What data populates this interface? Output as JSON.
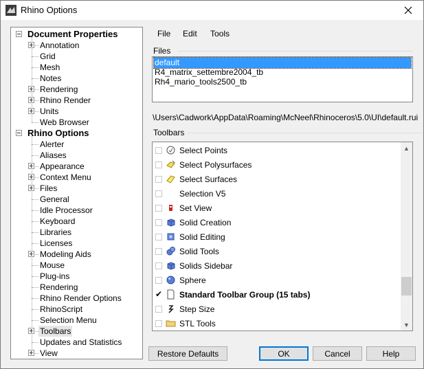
{
  "window": {
    "title": "Rhino Options"
  },
  "tree": {
    "items": [
      {
        "label": "Document Properties",
        "level": 0,
        "bold": true,
        "expander": "minus"
      },
      {
        "label": "Annotation",
        "level": 1,
        "expander": "plus"
      },
      {
        "label": "Grid",
        "level": 1
      },
      {
        "label": "Mesh",
        "level": 1
      },
      {
        "label": "Notes",
        "level": 1
      },
      {
        "label": "Rendering",
        "level": 1,
        "expander": "plus"
      },
      {
        "label": "Rhino Render",
        "level": 1,
        "expander": "plus"
      },
      {
        "label": "Units",
        "level": 1,
        "expander": "plus"
      },
      {
        "label": "Web Browser",
        "level": 1
      },
      {
        "label": "Rhino Options",
        "level": 0,
        "bold": true,
        "expander": "minus"
      },
      {
        "label": "Alerter",
        "level": 1
      },
      {
        "label": "Aliases",
        "level": 1
      },
      {
        "label": "Appearance",
        "level": 1,
        "expander": "plus"
      },
      {
        "label": "Context Menu",
        "level": 1,
        "expander": "plus"
      },
      {
        "label": "Files",
        "level": 1,
        "expander": "plus"
      },
      {
        "label": "General",
        "level": 1
      },
      {
        "label": "Idle Processor",
        "level": 1
      },
      {
        "label": "Keyboard",
        "level": 1
      },
      {
        "label": "Libraries",
        "level": 1
      },
      {
        "label": "Licenses",
        "level": 1
      },
      {
        "label": "Modeling Aids",
        "level": 1,
        "expander": "plus"
      },
      {
        "label": "Mouse",
        "level": 1
      },
      {
        "label": "Plug-ins",
        "level": 1
      },
      {
        "label": "Rendering",
        "level": 1
      },
      {
        "label": "Rhino Render Options",
        "level": 1
      },
      {
        "label": "RhinoScript",
        "level": 1
      },
      {
        "label": "Selection Menu",
        "level": 1
      },
      {
        "label": "Toolbars",
        "level": 1,
        "expander": "plus",
        "selected": true
      },
      {
        "label": "Updates and Statistics",
        "level": 1
      },
      {
        "label": "View",
        "level": 1,
        "expander": "plus"
      }
    ]
  },
  "menu": {
    "items": [
      "File",
      "Edit",
      "Tools"
    ]
  },
  "files": {
    "label": "Files",
    "items": [
      {
        "name": "default",
        "selected": true
      },
      {
        "name": "R4_matrix_settembre2004_tb"
      },
      {
        "name": "Rh4_mario_tools2500_tb"
      }
    ],
    "path": "\\Users\\Cadwork\\AppData\\Roaming\\McNeel\\Rhinoceros\\5.0\\UI\\default.rui"
  },
  "toolbars": {
    "label": "Toolbars",
    "items": [
      {
        "label": "Select Points",
        "icon": "select-points-icon",
        "checked": false
      },
      {
        "label": "Select Polysurfaces",
        "icon": "select-polysurfaces-icon",
        "checked": false
      },
      {
        "label": "Select Surfaces",
        "icon": "select-surfaces-icon",
        "checked": false
      },
      {
        "label": "Selection V5",
        "icon": "",
        "checked": false
      },
      {
        "label": "Set View",
        "icon": "set-view-icon",
        "checked": false
      },
      {
        "label": "Solid Creation",
        "icon": "solid-box-icon",
        "checked": false
      },
      {
        "label": "Solid Editing",
        "icon": "solid-edit-icon",
        "checked": false
      },
      {
        "label": "Solid Tools",
        "icon": "solid-tools-icon",
        "checked": false
      },
      {
        "label": "Solids Sidebar",
        "icon": "solid-box-icon",
        "checked": false
      },
      {
        "label": "Sphere",
        "icon": "sphere-icon",
        "checked": false
      },
      {
        "label": "Standard Toolbar Group (15 tabs)",
        "icon": "page-icon",
        "checked": true,
        "bold": true
      },
      {
        "label": "Step Size",
        "icon": "step-size-icon",
        "checked": false
      },
      {
        "label": "STL Tools",
        "icon": "folder-icon",
        "checked": false
      }
    ]
  },
  "buttons": {
    "restore": "Restore Defaults",
    "ok": "OK",
    "cancel": "Cancel",
    "help": "Help"
  }
}
